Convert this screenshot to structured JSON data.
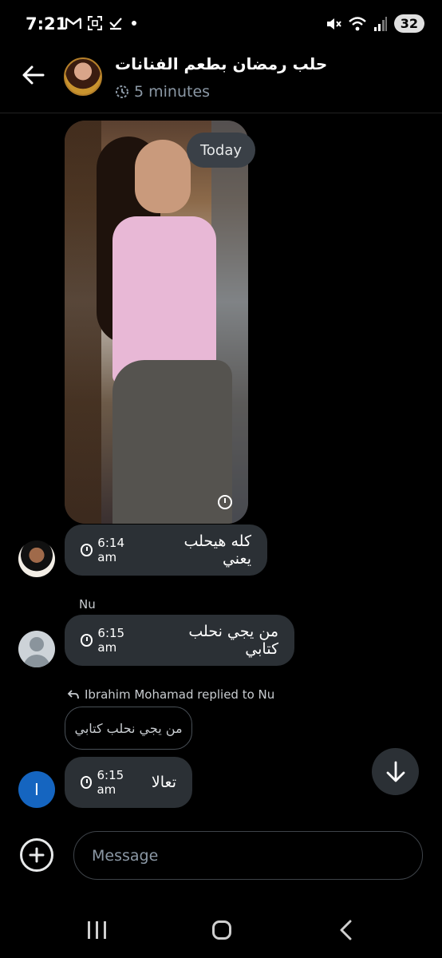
{
  "status_bar": {
    "time": "7:21",
    "battery": "32",
    "left_icons": [
      "gmail-icon",
      "screenshot-icon",
      "check-icon",
      "dot-icon"
    ],
    "right_icons": [
      "mute-icon",
      "wifi-icon",
      "signal-icon",
      "battery-icon"
    ]
  },
  "header": {
    "title": "حلب رمضان بطعم الفنانات",
    "subtitle": "5 minutes"
  },
  "conversation": {
    "date_chip": "Today",
    "messages": [
      {
        "text": "كله هيحلب يعني",
        "time": "6:14 am"
      },
      {
        "sender": "Nu",
        "text": "من يجي نحلب كتابي",
        "time": "6:15 am"
      },
      {
        "reply_label": "Ibrahim Mohamad replied to Nu",
        "quoted": "من يجي نحلب كتابي",
        "text": "تعالا",
        "time": "6:15 am",
        "avatar_letter": "I"
      }
    ]
  },
  "composer": {
    "placeholder": "Message"
  },
  "colors": {
    "bubble": "#2b3035",
    "background": "#000000",
    "avatar_blue": "#1565c0"
  }
}
